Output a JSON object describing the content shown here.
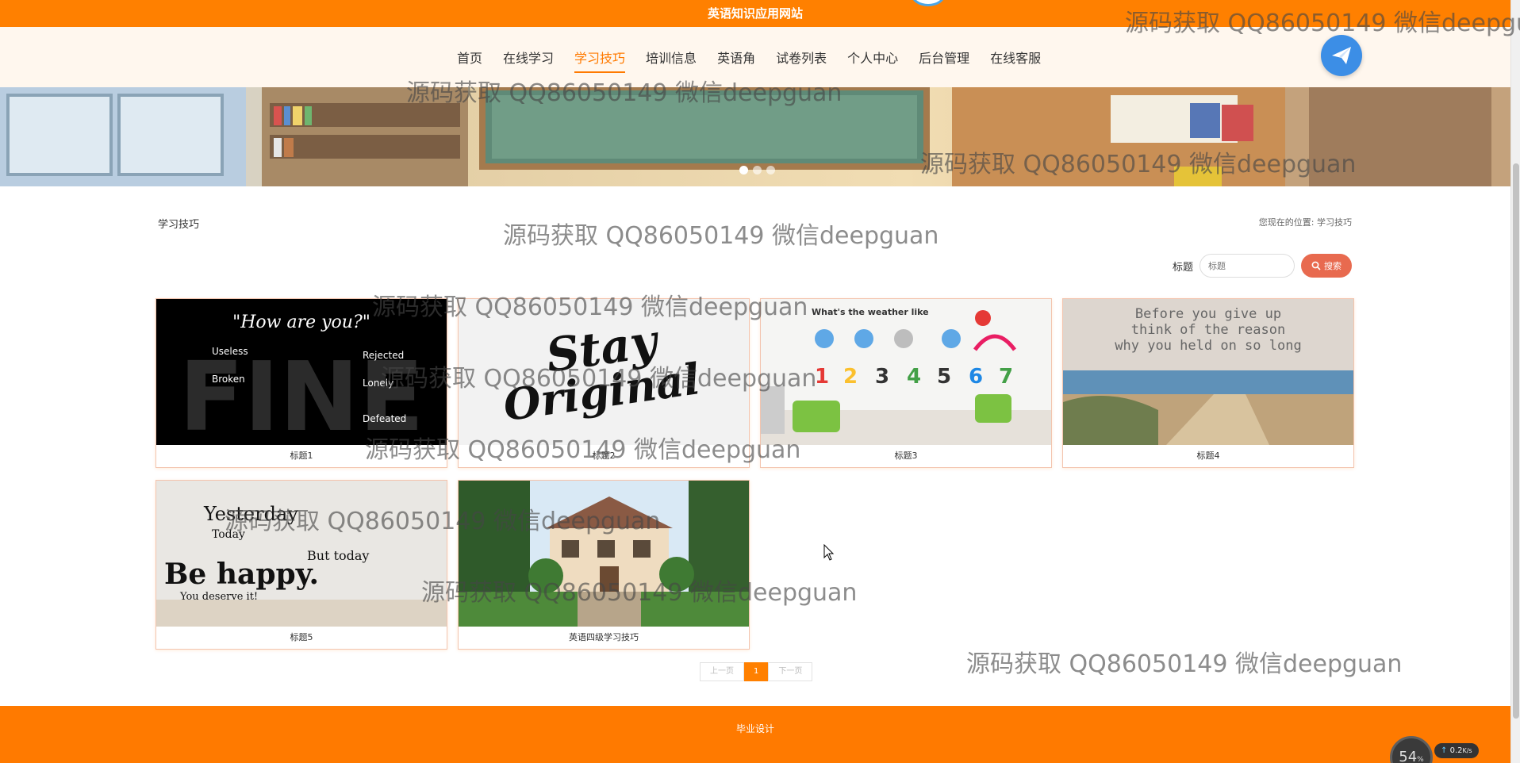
{
  "header": {
    "site_title": "英语知识应用网站"
  },
  "nav": {
    "items": [
      {
        "label": "首页"
      },
      {
        "label": "在线学习"
      },
      {
        "label": "学习技巧",
        "active": true
      },
      {
        "label": "培训信息"
      },
      {
        "label": "英语角"
      },
      {
        "label": "试卷列表"
      },
      {
        "label": "个人中心"
      },
      {
        "label": "后台管理"
      },
      {
        "label": "在线客服"
      }
    ],
    "logo_icon": "paper-plane-icon"
  },
  "banner": {
    "slide_count": 3,
    "active_slide": 1
  },
  "page": {
    "section_title": "学习技巧",
    "location_label": "您现在的位置:",
    "location_value": "学习技巧"
  },
  "search": {
    "label": "标题",
    "placeholder": "标题",
    "button_label": "搜索",
    "button_icon": "search-icon"
  },
  "cards": [
    {
      "title": "标题1",
      "image": "FINE words poster",
      "image_texts": [
        "\"How are you?\"",
        "FINE",
        "Useless",
        "Broken",
        "Rejected",
        "Lonely",
        "Defeated"
      ]
    },
    {
      "title": "标题2",
      "image": "Stay Original lettering",
      "image_texts": [
        "Stay",
        "Original"
      ]
    },
    {
      "title": "标题3",
      "image": "weather wall decal",
      "image_texts": [
        "What's the weather like",
        "1",
        "2",
        "3",
        "4",
        "5",
        "6",
        "7"
      ]
    },
    {
      "title": "标题4",
      "image": "beach path with quote",
      "image_texts": [
        "Before you give up",
        "think of the reason",
        "why you held on so long"
      ]
    },
    {
      "title": "标题5",
      "image": "yesterday be happy wall text",
      "image_texts": [
        "Yesterday",
        "Today",
        "But today",
        "Be happy.",
        "You deserve it!"
      ]
    },
    {
      "title": "英语四级学习技巧",
      "image": "house with garden"
    }
  ],
  "pagination": {
    "prev_label": "上一页",
    "current_page": "1",
    "next_label": "下一页"
  },
  "footer": {
    "text": "毕业设计"
  },
  "watermark": {
    "text": "源码获取 QQ86050149 微信deepguan",
    "text_clipped": "源码获取 QQ86050149 微信deepgu"
  },
  "widget": {
    "percent": "54",
    "percent_unit": "%",
    "speed": "0.2",
    "speed_unit": "K/s"
  },
  "colors": {
    "primary": "#ff8000",
    "accent": "#ff7a00",
    "search_button": "#e86a4f",
    "nav_bg": "#fff7ee"
  }
}
